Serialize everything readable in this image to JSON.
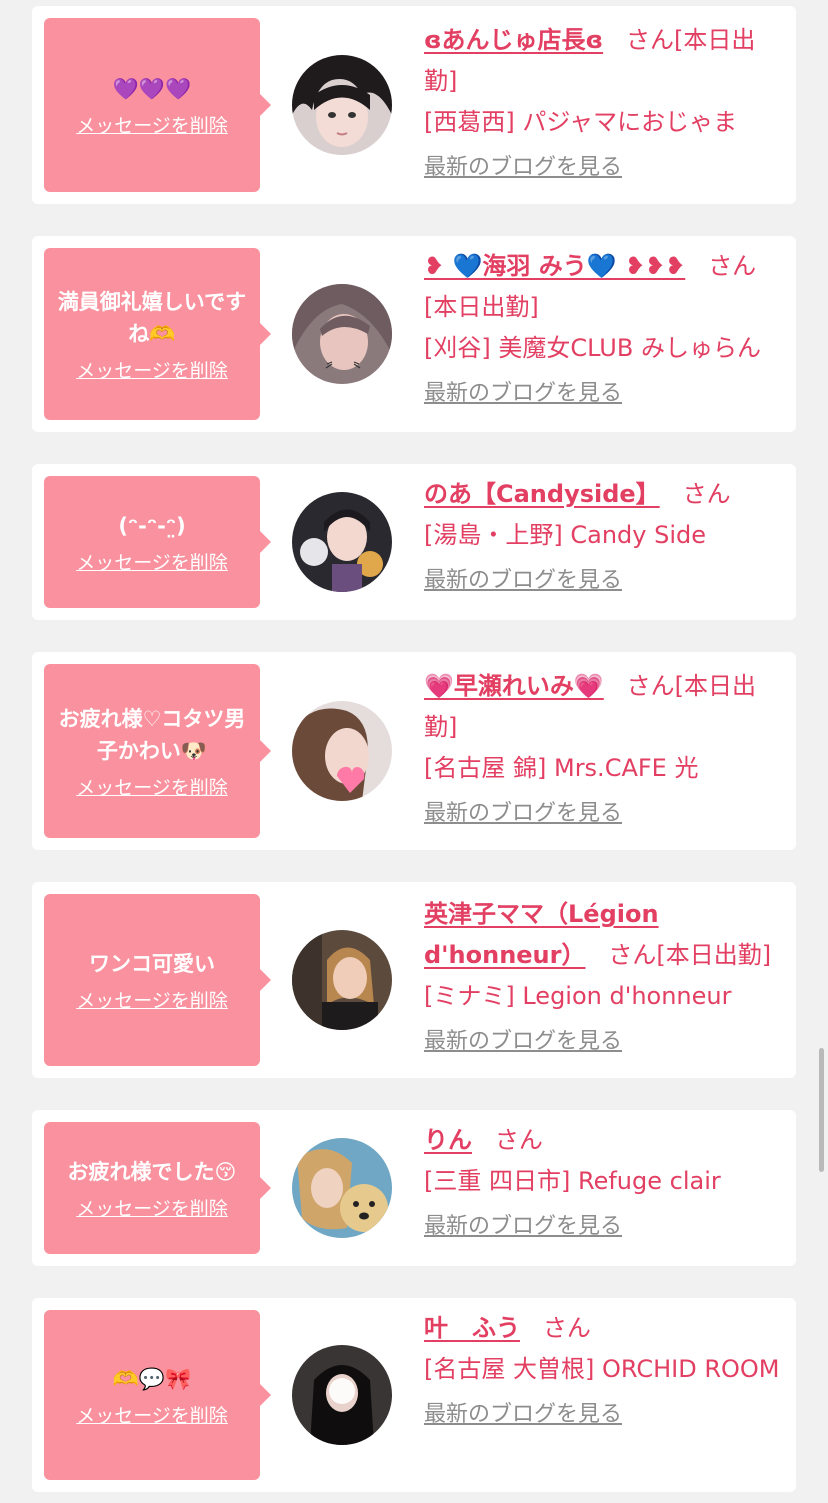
{
  "delete_label": "メッセージを削除",
  "blog_label": "最新のブログを見る",
  "san_label": "さん",
  "colors": {
    "bubble": "#f9929e",
    "accent": "#e23f62",
    "link_gray": "#8d8d8d",
    "background": "#f1f1f1"
  },
  "messages": [
    {
      "message": "💜💜💜",
      "name": "ɞあんじゅ店長ɞ",
      "status": "[本日出勤]",
      "shop": "[西葛西] パジャマにおじゃま"
    },
    {
      "message": "満員御礼嬉しいですね🫶",
      "name": "❥ 💙海羽 みう💙 ❥❥❥",
      "status": "[本日出勤]",
      "shop": "[刈谷] 美魔女CLUB みしゅらん"
    },
    {
      "message": "(ᵔ-ᵔ-ᵔ̤)",
      "name": "のあ【Candyside】",
      "status": "",
      "shop": "[湯島・上野] Candy Side"
    },
    {
      "message": "お疲れ様♡コタツ男子かわい🐶",
      "name": "💗早瀬れいみ💗",
      "status": "[本日出勤]",
      "shop": "[名古屋 錦] Mrs.CAFE 光"
    },
    {
      "message": "ワンコ可愛い",
      "name": "英津子ママ（Légion d'honneur）",
      "status": "[本日出勤]",
      "shop": "[ミナミ] Legion d'honneur"
    },
    {
      "message": "お疲れ様でした😚",
      "name": "りん",
      "status": "",
      "shop": "[三重 四日市] Refuge clair"
    },
    {
      "message": "🫶💬🎀",
      "name": "叶　ふう",
      "status": "",
      "shop": "[名古屋 大曽根] ORCHID ROOM"
    }
  ]
}
